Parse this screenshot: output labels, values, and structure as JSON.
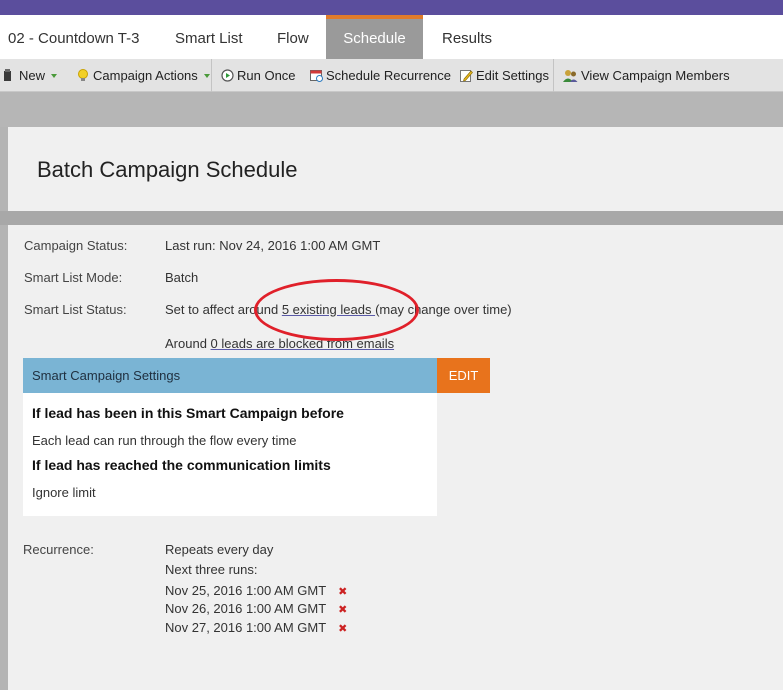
{
  "tabs": {
    "program": "02 - Countdown T-3",
    "smart_list": "Smart List",
    "flow": "Flow",
    "schedule": "Schedule",
    "results": "Results"
  },
  "toolbar": {
    "new": "New",
    "campaign_actions": "Campaign Actions",
    "run_once": "Run Once",
    "schedule_recurrence": "Schedule Recurrence",
    "edit_settings": "Edit Settings",
    "view_members": "View Campaign Members"
  },
  "page_title": "Batch Campaign Schedule",
  "status": {
    "campaign_status_label": "Campaign Status:",
    "campaign_status_value": "Last run: Nov 24, 2016 1:00 AM GMT",
    "mode_label": "Smart List Mode:",
    "mode_value": "Batch",
    "list_status_label": "Smart List Status:",
    "list_status_prefix": "Set to affect around ",
    "list_status_link": "5 existing leads ",
    "list_status_suffix": "(may change over time)",
    "blocked_prefix": "Around ",
    "blocked_link": "0 leads are blocked from emails"
  },
  "settings": {
    "header": "Smart Campaign Settings",
    "edit": "EDIT",
    "q1": "If lead has been in this Smart Campaign before",
    "a1": "Each lead can run through the flow every time",
    "q2": "If lead has reached the communication limits",
    "a2": "Ignore limit"
  },
  "recurrence": {
    "label": "Recurrence:",
    "repeat": "Repeats every day",
    "next_label": "Next three runs:",
    "runs": [
      "Nov 25, 2016 1:00 AM GMT",
      "Nov 26, 2016 1:00 AM GMT",
      "Nov 27, 2016 1:00 AM GMT"
    ],
    "delete_glyph": "✖"
  },
  "colors": {
    "header_purple": "#5b4e9d",
    "active_tab_accent": "#e07b2a",
    "settings_header": "#7ab4d4",
    "edit_button": "#e8731c",
    "annotation_red": "#e0202a"
  }
}
